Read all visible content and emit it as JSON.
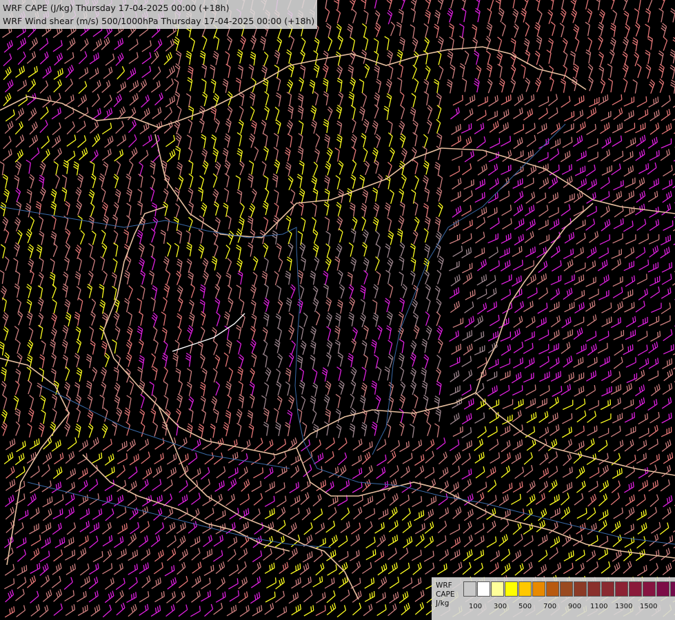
{
  "header": {
    "line1": "WRF CAPE (J/kg) Thursday 17-04-2025 00:00 (+18h)",
    "line2": "WRF Wind shear (m/s) 500/1000hPa Thursday 17-04-2025 00:00 (+18h)"
  },
  "legend": {
    "labels": [
      "WRF",
      "CAPE",
      "J/kg"
    ],
    "colors": [
      "#c8c8c8",
      "#ffffff",
      "#ffff9a",
      "#ffff00",
      "#ffc800",
      "#e88a00",
      "#b85a10",
      "#9a4a20",
      "#8c3a26",
      "#8a302c",
      "#8a2a30",
      "#8c2234",
      "#8a1a3a",
      "#861440",
      "#7c0c46",
      "#720a4a",
      "#680848"
    ],
    "ticks": [
      "100",
      "300",
      "500",
      "700",
      "900",
      "1100",
      "1300",
      "1500"
    ]
  },
  "barb_colors": {
    "low": "#d08080",
    "mid": "#e87878",
    "high": "#e020e0",
    "yellow": "#ffff20",
    "grey": "#a08890"
  }
}
